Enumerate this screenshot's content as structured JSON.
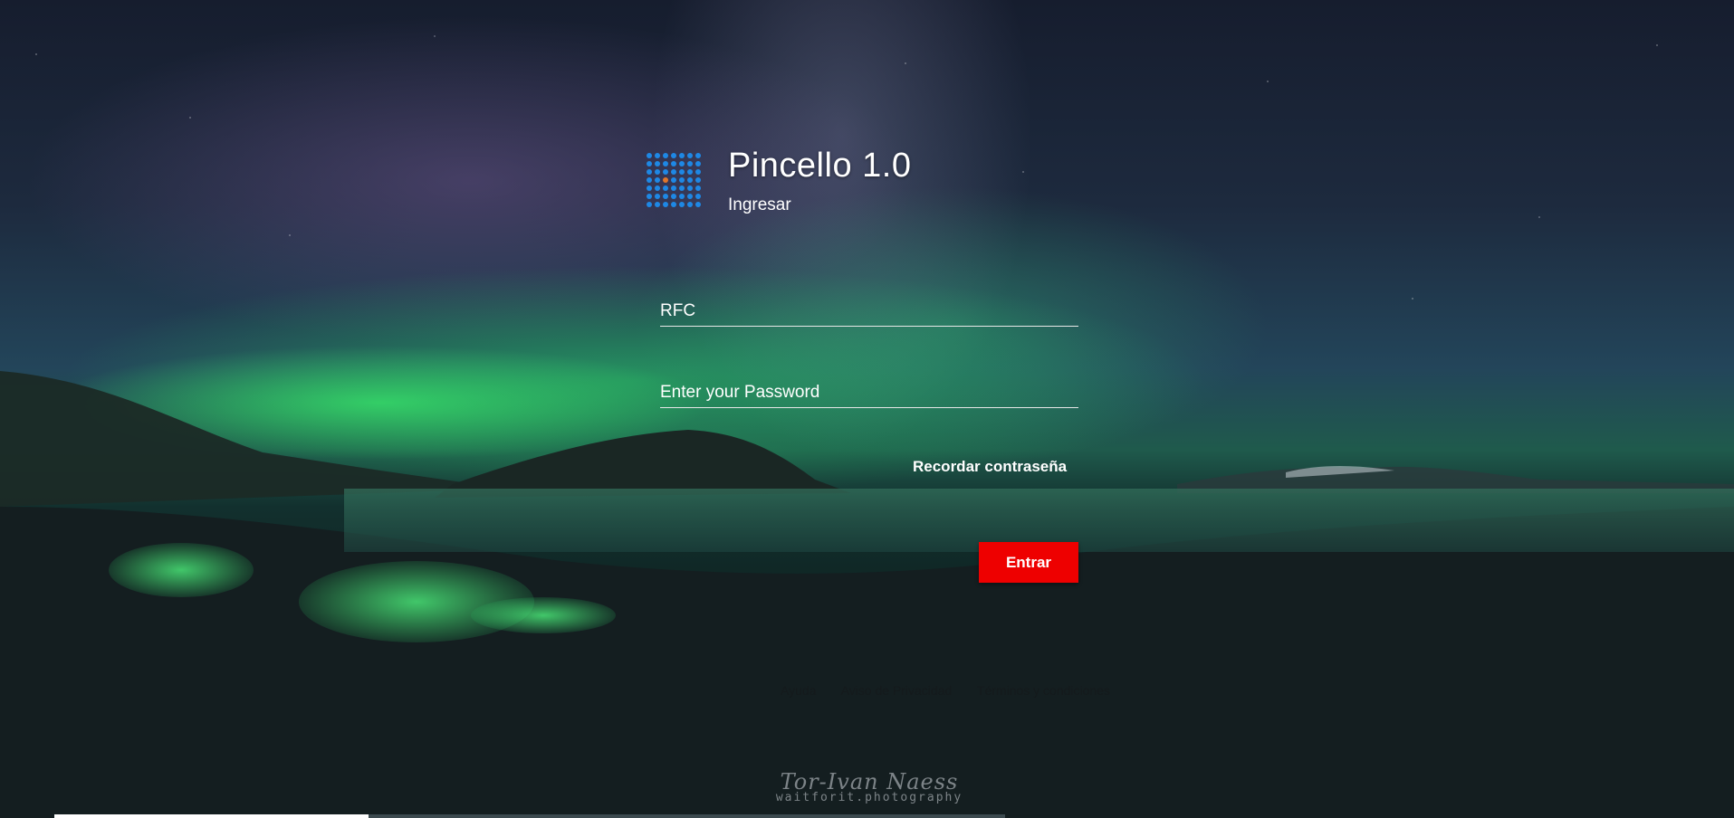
{
  "app": {
    "title": "Pincello 1.0",
    "subtitle": "Ingresar"
  },
  "form": {
    "rfc_placeholder": "RFC",
    "password_placeholder": "Enter your Password",
    "remember_label": "Recordar contraseña",
    "submit_label": "Entrar"
  },
  "footer": {
    "links": [
      "Ayuda",
      "Aviso de Privacidad",
      "Términos y condiciones"
    ]
  },
  "background": {
    "signature_name": "Tor-Ivan Naess",
    "signature_site": "waitforit.photography"
  },
  "slideshow": {
    "progress_fraction": 0.33
  },
  "colors": {
    "accent": "#ee0000",
    "logo_dots": "#1e88e5",
    "logo_highlight": "#e0762b"
  }
}
